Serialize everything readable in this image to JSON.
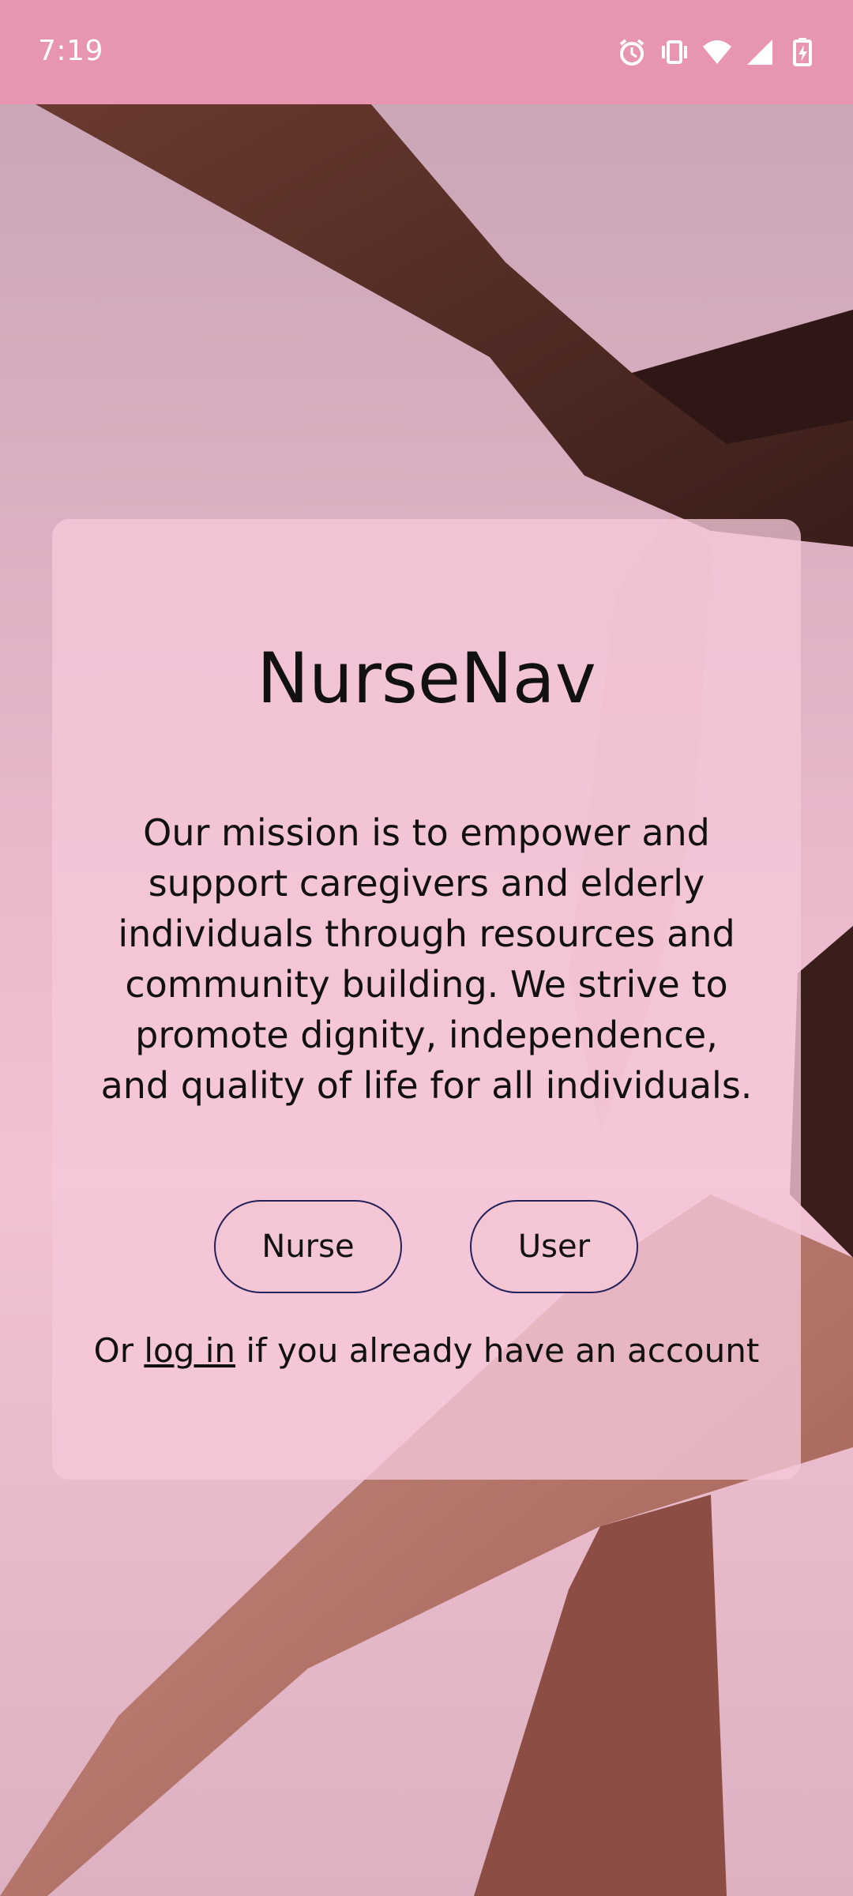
{
  "status_bar": {
    "time": "7:19",
    "icons": [
      "alarm-icon",
      "vibrate-icon",
      "wifi-icon",
      "signal-icon",
      "battery-charging-icon"
    ]
  },
  "app": {
    "title": "NurseNav",
    "mission": "Our mission is to empower and support caregivers and elderly individuals through resources and community building. We strive to promote dignity, independence, and quality of life for all individuals.",
    "buttons": {
      "nurse": "Nurse",
      "user": "User"
    },
    "login": {
      "prefix": "Or ",
      "link": "log in",
      "suffix": " if you already have an account"
    }
  },
  "colors": {
    "status_bar": "#e795b0",
    "card": "#f6c8da",
    "button_border": "#22215b",
    "button_fill": "#f4c5d2"
  }
}
